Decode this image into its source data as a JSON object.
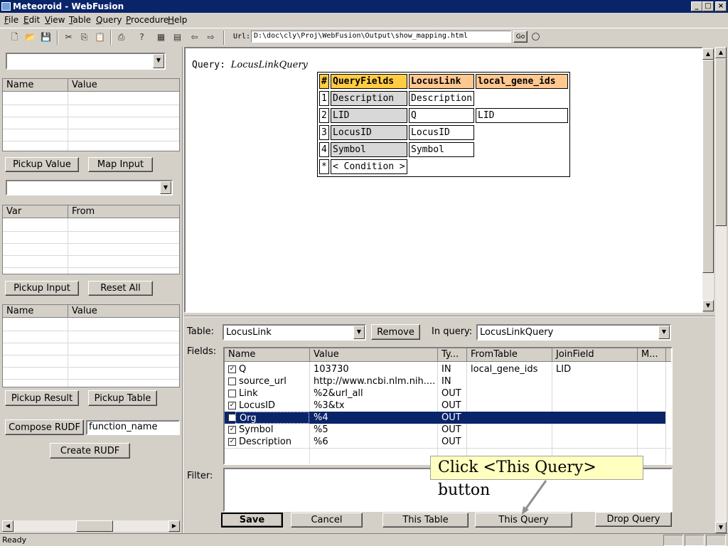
{
  "window": {
    "title": "Meteoroid - WebFusion"
  },
  "menu": [
    "File",
    "Edit",
    "View",
    "Table",
    "Query",
    "Procedure",
    "Help"
  ],
  "toolbar": {
    "url_label": "Url:",
    "url_value": "D:\\doc\\cly\\Proj\\WebFusion\\Output\\show_mapping.html",
    "go_label": "Go"
  },
  "left": {
    "grid1": {
      "col1": "Name",
      "col2": "Value"
    },
    "pickup_value": "Pickup Value",
    "map_input": "Map Input",
    "grid2": {
      "col1": "Var",
      "col2": "From"
    },
    "pickup_input": "Pickup Input",
    "reset_all": "Reset All",
    "grid3": {
      "col1": "Name",
      "col2": "Value"
    },
    "pickup_result": "Pickup Result",
    "pickup_table": "Pickup Table",
    "compose_rudf": "Compose RUDF",
    "function_name": "function_name",
    "create_rudf": "Create RUDF"
  },
  "query_view": {
    "label": "Query:",
    "name": "LocusLinkQuery",
    "headers": [
      "#",
      "QueryFields",
      "LocusLink",
      "local_gene_ids"
    ],
    "rows": [
      {
        "n": "1",
        "field": "Description",
        "ll": "Description",
        "lg": ""
      },
      {
        "n": "2",
        "field": "LID",
        "ll": "Q",
        "lg": "LID"
      },
      {
        "n": "3",
        "field": "LocusID",
        "ll": "LocusID",
        "lg": ""
      },
      {
        "n": "4",
        "field": "Symbol",
        "ll": "Symbol",
        "lg": ""
      },
      {
        "n": "*",
        "field": "< Condition >",
        "ll": "",
        "lg": ""
      }
    ]
  },
  "editor": {
    "table_label": "Table:",
    "table_value": "LocusLink",
    "remove": "Remove",
    "inquery_label": "In query:",
    "inquery_value": "LocusLinkQuery",
    "fields_label": "Fields:",
    "columns": [
      "Name",
      "Value",
      "Ty...",
      "FromTable",
      "JoinField",
      "M..."
    ],
    "rows": [
      {
        "checked": true,
        "name": "Q",
        "value": "103730",
        "type": "IN",
        "from": "local_gene_ids",
        "join": "LID"
      },
      {
        "checked": false,
        "name": "source_url",
        "value": "http://www.ncbi.nlm.nih....",
        "type": "IN",
        "from": "",
        "join": ""
      },
      {
        "checked": false,
        "name": "Link",
        "value": "%2&url_all",
        "type": "OUT",
        "from": "",
        "join": ""
      },
      {
        "checked": true,
        "name": "LocusID",
        "value": "%3&tx",
        "type": "OUT",
        "from": "",
        "join": ""
      },
      {
        "checked": false,
        "name": "Org",
        "value": "%4",
        "type": "OUT",
        "from": "",
        "join": ""
      },
      {
        "checked": true,
        "name": "Symbol",
        "value": "%5",
        "type": "OUT",
        "from": "",
        "join": ""
      },
      {
        "checked": true,
        "name": "Description",
        "value": "%6",
        "type": "OUT",
        "from": "",
        "join": ""
      }
    ],
    "filter_label": "Filter:",
    "save": "Save",
    "cancel": "Cancel",
    "this_table": "This Table",
    "this_query": "This Query",
    "drop_query": "Drop Query"
  },
  "callout": "Click <This Query> button",
  "status": "Ready"
}
